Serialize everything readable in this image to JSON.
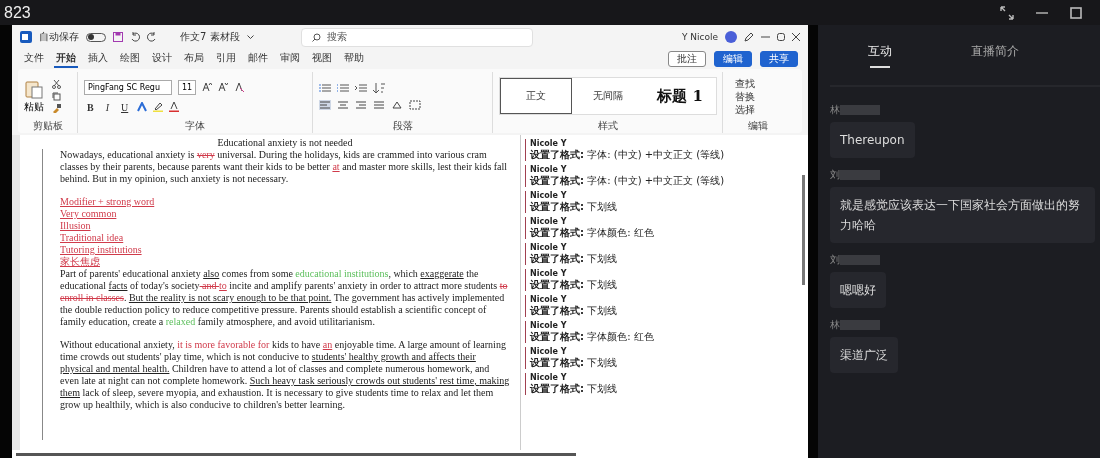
{
  "stream": {
    "title": "823"
  },
  "word": {
    "autosave_label": "自动保存",
    "autosave_on": false,
    "doc_title": "作文7 素材段",
    "search_placeholder": "搜索",
    "user": "Y Nicole",
    "menu_tabs": [
      {
        "label": "文件",
        "selected": false
      },
      {
        "label": "开始",
        "selected": true
      },
      {
        "label": "插入",
        "selected": false
      },
      {
        "label": "绘图",
        "selected": false
      },
      {
        "label": "设计",
        "selected": false
      },
      {
        "label": "布局",
        "selected": false
      },
      {
        "label": "引用",
        "selected": false
      },
      {
        "label": "邮件",
        "selected": false
      },
      {
        "label": "审阅",
        "selected": false
      },
      {
        "label": "视图",
        "selected": false
      },
      {
        "label": "帮助",
        "selected": false
      }
    ],
    "action_buttons": [
      {
        "label": "批注",
        "kind": "outline"
      },
      {
        "label": "编辑",
        "kind": "primary"
      },
      {
        "label": "共享",
        "kind": "primary"
      }
    ],
    "ribbon": {
      "paste_label": "粘贴",
      "font_name": "PingFang SC Regu",
      "font_size": "11",
      "format_buttons": [
        "B",
        "I",
        "U"
      ],
      "styles": [
        {
          "label": "正文",
          "selected": true
        },
        {
          "label": "无间隔",
          "selected": false
        },
        {
          "label": "标题 1",
          "selected": false
        }
      ],
      "edit_items": [
        "查找",
        "替换",
        "选择"
      ],
      "groups": [
        "剪贴板",
        "字体",
        "段落",
        "样式",
        "编辑"
      ]
    },
    "paragraphs": [
      {
        "kind": "title",
        "runs": [
          {
            "kind": "plain",
            "text": "Educational anxiety is not needed"
          }
        ]
      },
      {
        "kind": "body",
        "runs": [
          {
            "kind": "plain",
            "text": "Nowadays, educational anxiety is "
          },
          {
            "kind": "deleted",
            "text": "very"
          },
          {
            "kind": "plain",
            "text": " universal. During the holidays, kids are crammed into various cram classes by their parents, because parents want their kids to be better "
          },
          {
            "kind": "inserted",
            "text": "at"
          },
          {
            "kind": "plain",
            "text": " and master more skills, lest their kids fall behind. But in my opinion, such anxiety is not necessary."
          }
        ]
      },
      {
        "kind": "blank"
      },
      {
        "kind": "body",
        "runs": [
          {
            "kind": "inserted",
            "text": "Modifier + strong word"
          }
        ]
      },
      {
        "kind": "body",
        "runs": [
          {
            "kind": "inserted",
            "text": "Very common"
          }
        ]
      },
      {
        "kind": "body",
        "runs": [
          {
            "kind": "inserted",
            "text": "Illusion"
          }
        ]
      },
      {
        "kind": "body",
        "runs": [
          {
            "kind": "inserted",
            "text": "Traditional idea"
          }
        ]
      },
      {
        "kind": "body",
        "runs": [
          {
            "kind": "inserted",
            "text": "Tutoring institutions"
          }
        ]
      },
      {
        "kind": "body",
        "runs": [
          {
            "kind": "inserted",
            "text": "家长焦虑"
          }
        ]
      },
      {
        "kind": "body",
        "runs": [
          {
            "kind": "plain",
            "text": "Part of parents' educational anxiety "
          },
          {
            "kind": "underline",
            "text": "also"
          },
          {
            "kind": "plain",
            "text": " comes from some "
          },
          {
            "kind": "green",
            "text": "educational institutions"
          },
          {
            "kind": "plain",
            "text": ", which "
          },
          {
            "kind": "underline",
            "text": "exaggerate"
          },
          {
            "kind": "plain",
            "text": " the educational "
          },
          {
            "kind": "underline",
            "text": "facts"
          },
          {
            "kind": "plain",
            "text": " of today's society"
          },
          {
            "kind": "deleted",
            "text": " and "
          },
          {
            "kind": "inserted",
            "text": "to"
          },
          {
            "kind": "plain",
            "text": " incite and amplify parents' anxiety in order to attract more students "
          },
          {
            "kind": "deleted",
            "text": "to enroll in classes"
          },
          {
            "kind": "plain",
            "text": ". "
          },
          {
            "kind": "underline",
            "text": "But the reality is not scary enough to be that point."
          },
          {
            "kind": "plain",
            "text": " The government has actively implemented the double reduction policy to reduce competitive pressure. Parents should establish a scientific concept of family education, create a "
          },
          {
            "kind": "green",
            "text": "relaxed"
          },
          {
            "kind": "plain",
            "text": " family atmosphere, and avoid utilitarianism."
          }
        ]
      },
      {
        "kind": "blank"
      },
      {
        "kind": "body",
        "runs": [
          {
            "kind": "plain",
            "text": "Without educational anxiety, "
          },
          {
            "kind": "red",
            "text": "it is more favorable for"
          },
          {
            "kind": "plain",
            "text": " kids to have "
          },
          {
            "kind": "inserted",
            "text": "an"
          },
          {
            "kind": "plain",
            "text": " enjoyable time. A large amount of learning time crowds out students' play time, which is not conducive to "
          },
          {
            "kind": "underline",
            "text": "students' healthy growth and affects their physical and mental health."
          },
          {
            "kind": "plain",
            "text": " Children have to attend a lot of classes and complete numerous homework, and even late at night can not complete homework. "
          },
          {
            "kind": "underline",
            "text": "Such heavy task seriously crowds out students' rest time, "
          },
          {
            "kind": "underline",
            "text": "making them"
          },
          {
            "kind": "plain",
            "text": " lack of sleep, severe myopia, and exhaustion. It is necessary to give students time to relax and let them grow up healthily, which is also conducive to children's better learning."
          }
        ]
      }
    ],
    "comments": [
      {
        "author": "Nicole Y",
        "text": "**设置了格式:** 字体: (中文) +中文正文 (等线)"
      },
      {
        "author": "Nicole Y",
        "text": "**设置了格式:** 字体: (中文) +中文正文 (等线)"
      },
      {
        "author": "Nicole Y",
        "text": "**设置了格式:** 下划线"
      },
      {
        "author": "Nicole Y",
        "text": "**设置了格式:** 字体颜色: 红色"
      },
      {
        "author": "Nicole Y",
        "text": "**设置了格式:** 下划线"
      },
      {
        "author": "Nicole Y",
        "text": "**设置了格式:** 下划线"
      },
      {
        "author": "Nicole Y",
        "text": "**设置了格式:** 下划线"
      },
      {
        "author": "Nicole Y",
        "text": "**设置了格式:** 字体颜色: 红色"
      },
      {
        "author": "Nicole Y",
        "text": "**设置了格式:** 下划线"
      },
      {
        "author": "Nicole Y",
        "text": "**设置了格式:** 下划线"
      }
    ]
  },
  "panel": {
    "tabs": [
      {
        "label": "互动",
        "selected": true
      },
      {
        "label": "直播简介",
        "selected": false
      }
    ],
    "messages": [
      {
        "name": "林",
        "text": "Thereupon"
      },
      {
        "name": "刘",
        "text": "就是感觉应该表达一下国家社会方面做出的努力哈哈"
      },
      {
        "name": "刘",
        "text": "嗯嗯好"
      },
      {
        "name": "林",
        "text": "渠道广泛"
      }
    ]
  }
}
